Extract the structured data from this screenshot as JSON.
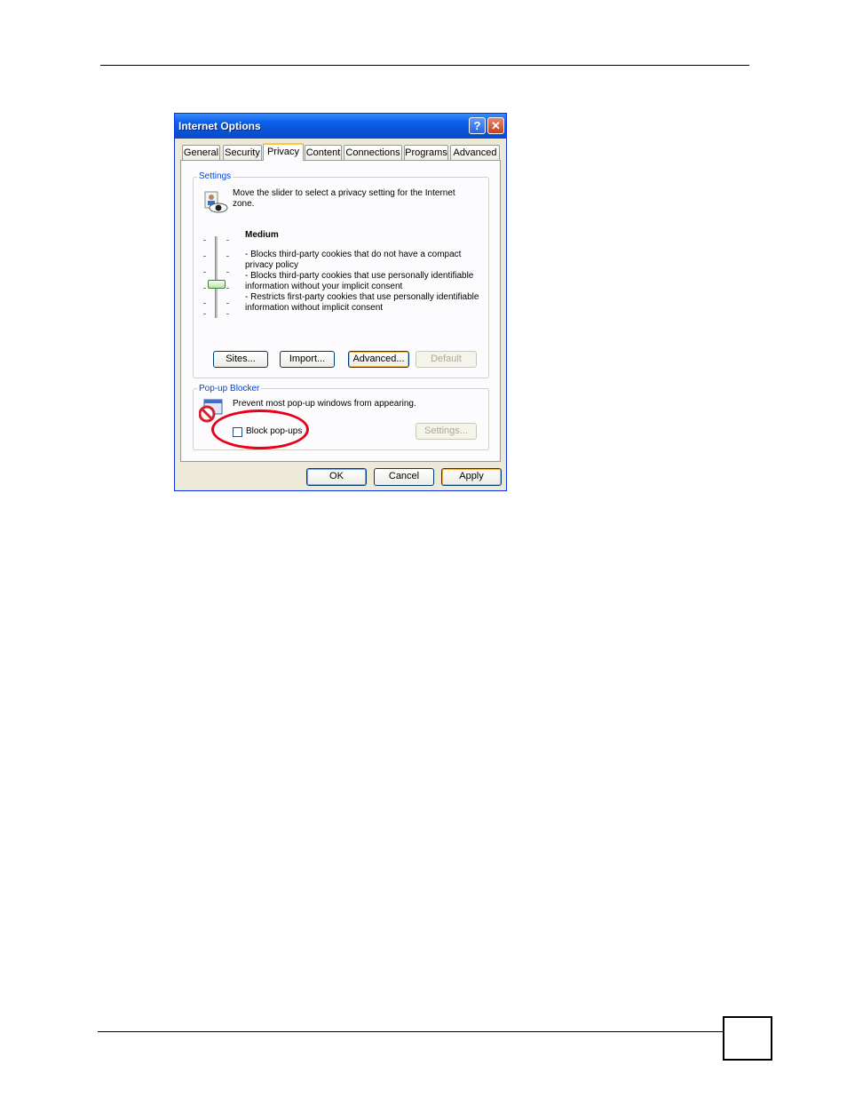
{
  "dialog": {
    "title": "Internet Options",
    "help_button": "?",
    "close_button": "✕",
    "tabs": [
      "General",
      "Security",
      "Privacy",
      "Content",
      "Connections",
      "Programs",
      "Advanced"
    ],
    "active_tab": "Privacy"
  },
  "settings_group": {
    "label": "Settings",
    "description_line1": "Move the slider to select a privacy setting for the Internet",
    "description_line2": "zone.",
    "level_title": "Medium",
    "level_description": [
      "- Blocks third-party cookies that do not have a compact",
      "privacy policy",
      "- Blocks third-party cookies that use personally identifiable",
      "information without your implicit consent",
      "- Restricts first-party cookies that use personally identifiable",
      "information without implicit consent"
    ],
    "slider_level": "Medium",
    "buttons": {
      "sites": "Sites...",
      "import": "Import...",
      "advanced": "Advanced...",
      "default": "Default"
    }
  },
  "popup_group": {
    "label": "Pop-up Blocker",
    "description": "Prevent most pop-up windows from appearing.",
    "checkbox_label": "Block pop-ups",
    "checkbox_checked": false,
    "settings_button": "Settings..."
  },
  "footer_buttons": {
    "ok": "OK",
    "cancel": "Cancel",
    "apply": "Apply"
  },
  "colors": {
    "titlebar": "#0a5fe8",
    "highlight_ellipse": "#e8001c",
    "group_label": "#0046d5"
  }
}
